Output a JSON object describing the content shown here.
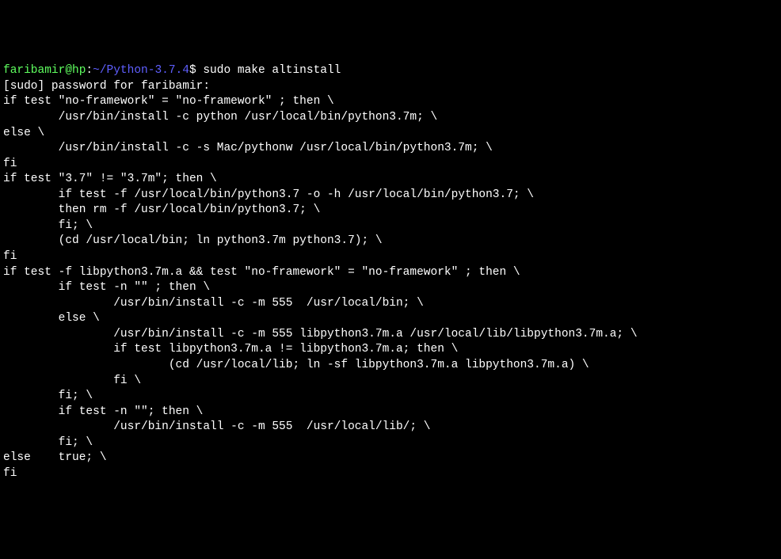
{
  "prompt": {
    "user": "faribamir@hp",
    "colon": ":",
    "path": "~/Python-3.7.4",
    "dollar": "$ ",
    "command": "sudo make altinstall"
  },
  "lines": [
    "[sudo] password for faribamir:",
    "if test \"no-framework\" = \"no-framework\" ; then \\",
    "        /usr/bin/install -c python /usr/local/bin/python3.7m; \\",
    "else \\",
    "        /usr/bin/install -c -s Mac/pythonw /usr/local/bin/python3.7m; \\",
    "fi",
    "if test \"3.7\" != \"3.7m\"; then \\",
    "        if test -f /usr/local/bin/python3.7 -o -h /usr/local/bin/python3.7; \\",
    "        then rm -f /usr/local/bin/python3.7; \\",
    "        fi; \\",
    "        (cd /usr/local/bin; ln python3.7m python3.7); \\",
    "fi",
    "if test -f libpython3.7m.a && test \"no-framework\" = \"no-framework\" ; then \\",
    "        if test -n \"\" ; then \\",
    "                /usr/bin/install -c -m 555  /usr/local/bin; \\",
    "        else \\",
    "                /usr/bin/install -c -m 555 libpython3.7m.a /usr/local/lib/libpython3.7m.a; \\",
    "                if test libpython3.7m.a != libpython3.7m.a; then \\",
    "                        (cd /usr/local/lib; ln -sf libpython3.7m.a libpython3.7m.a) \\",
    "                fi \\",
    "        fi; \\",
    "        if test -n \"\"; then \\",
    "                /usr/bin/install -c -m 555  /usr/local/lib/; \\",
    "        fi; \\",
    "else    true; \\",
    "fi"
  ]
}
